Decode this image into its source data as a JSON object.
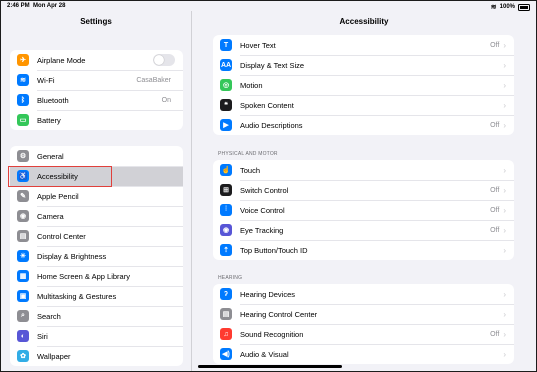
{
  "status": {
    "time": "2:46 PM",
    "date": "Mon Apr 28",
    "battery": "100%"
  },
  "sidebar": {
    "title": "Settings",
    "group1": [
      {
        "label": "Airplane Mode",
        "icon": "airplane-icon",
        "color": "#ff9500",
        "glyph": "✈",
        "value": "",
        "toggle": true
      },
      {
        "label": "Wi-Fi",
        "icon": "wifi-icon",
        "color": "#007aff",
        "glyph": "≋",
        "value": "CasaBaker"
      },
      {
        "label": "Bluetooth",
        "icon": "bluetooth-icon",
        "color": "#007aff",
        "glyph": "ᛒ",
        "value": "On"
      },
      {
        "label": "Battery",
        "icon": "battery-icon",
        "color": "#34c759",
        "glyph": "▭",
        "value": ""
      }
    ],
    "group2": [
      {
        "label": "General",
        "icon": "gear-icon",
        "color": "#8e8e93",
        "glyph": "⚙"
      },
      {
        "label": "Accessibility",
        "icon": "accessibility-icon",
        "color": "#007aff",
        "glyph": "♿",
        "selected": true
      },
      {
        "label": "Apple Pencil",
        "icon": "pencil-icon",
        "color": "#8e8e93",
        "glyph": "✎"
      },
      {
        "label": "Camera",
        "icon": "camera-icon",
        "color": "#8e8e93",
        "glyph": "◉"
      },
      {
        "label": "Control Center",
        "icon": "control-center-icon",
        "color": "#8e8e93",
        "glyph": "▤"
      },
      {
        "label": "Display & Brightness",
        "icon": "brightness-icon",
        "color": "#007aff",
        "glyph": "☀"
      },
      {
        "label": "Home Screen & App Library",
        "icon": "home-screen-icon",
        "color": "#007aff",
        "glyph": "▦"
      },
      {
        "label": "Multitasking & Gestures",
        "icon": "multitasking-icon",
        "color": "#007aff",
        "glyph": "▣"
      },
      {
        "label": "Search",
        "icon": "search-icon",
        "color": "#8e8e93",
        "glyph": "⌕"
      },
      {
        "label": "Siri",
        "icon": "siri-icon",
        "color": "#5856d6",
        "glyph": "◐"
      },
      {
        "label": "Wallpaper",
        "icon": "wallpaper-icon",
        "color": "#32ade6",
        "glyph": "✿"
      }
    ]
  },
  "main": {
    "title": "Accessibility",
    "group_vision": [
      {
        "label": "Hover Text",
        "icon": "hover-text-icon",
        "color": "#007aff",
        "glyph": "T",
        "value": "Off"
      },
      {
        "label": "Display & Text Size",
        "icon": "text-size-icon",
        "color": "#007aff",
        "glyph": "AA",
        "value": ""
      },
      {
        "label": "Motion",
        "icon": "motion-icon",
        "color": "#34c759",
        "glyph": "◎",
        "value": ""
      },
      {
        "label": "Spoken Content",
        "icon": "spoken-content-icon",
        "color": "#1c1c1e",
        "glyph": "❝",
        "value": ""
      },
      {
        "label": "Audio Descriptions",
        "icon": "audio-descriptions-icon",
        "color": "#007aff",
        "glyph": "▶",
        "value": "Off"
      }
    ],
    "section_physical": "PHYSICAL AND MOTOR",
    "group_physical": [
      {
        "label": "Touch",
        "icon": "touch-icon",
        "color": "#007aff",
        "glyph": "☝",
        "value": ""
      },
      {
        "label": "Switch Control",
        "icon": "switch-control-icon",
        "color": "#1c1c1e",
        "glyph": "⊞",
        "value": "Off"
      },
      {
        "label": "Voice Control",
        "icon": "voice-control-icon",
        "color": "#007aff",
        "glyph": "⫶",
        "value": "Off"
      },
      {
        "label": "Eye Tracking",
        "icon": "eye-tracking-icon",
        "color": "#5856d6",
        "glyph": "◉",
        "value": "Off"
      },
      {
        "label": "Top Button/Touch ID",
        "icon": "top-button-icon",
        "color": "#007aff",
        "glyph": "⇡",
        "value": ""
      }
    ],
    "section_hearing": "HEARING",
    "group_hearing": [
      {
        "label": "Hearing Devices",
        "icon": "ear-icon",
        "color": "#007aff",
        "glyph": "ʔ",
        "value": ""
      },
      {
        "label": "Hearing Control Center",
        "icon": "hearing-control-center-icon",
        "color": "#8e8e93",
        "glyph": "▤",
        "value": ""
      },
      {
        "label": "Sound Recognition",
        "icon": "sound-recognition-icon",
        "color": "#ff3b30",
        "glyph": "♫",
        "value": "Off"
      },
      {
        "label": "Audio & Visual",
        "icon": "audio-visual-icon",
        "color": "#007aff",
        "glyph": "◀)",
        "value": ""
      }
    ]
  }
}
